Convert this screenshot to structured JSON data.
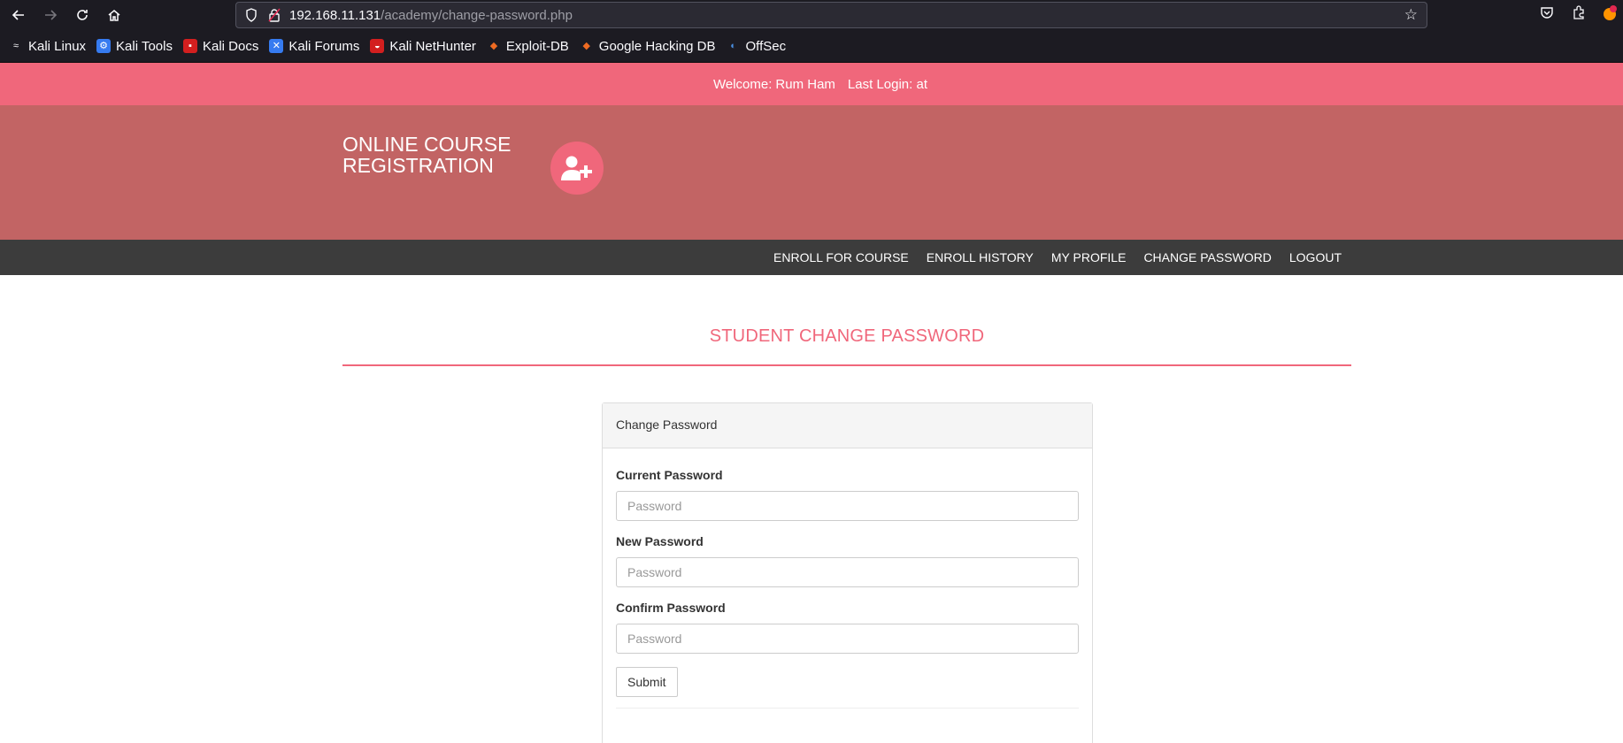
{
  "browser": {
    "url_host": "192.168.11.131",
    "url_path": "/academy/change-password.php",
    "bookmarks": [
      {
        "label": "Kali Linux",
        "color": "#367bf0"
      },
      {
        "label": "Kali Tools",
        "color": "#367bf0"
      },
      {
        "label": "Kali Docs",
        "color": "#d31f1f"
      },
      {
        "label": "Kali Forums",
        "color": "#367bf0"
      },
      {
        "label": "Kali NetHunter",
        "color": "#d31f1f"
      },
      {
        "label": "Exploit-DB",
        "color": "#ef6b22"
      },
      {
        "label": "Google Hacking DB",
        "color": "#ef6b22"
      },
      {
        "label": "OffSec",
        "color": "#4a90e2"
      }
    ]
  },
  "welcome": {
    "label": "Welcome:",
    "name": "Rum Ham",
    "last_login": "Last Login: at"
  },
  "header": {
    "logo_line1": "ONLINE COURSE",
    "logo_line2": "REGISTRATION"
  },
  "menu": [
    "ENROLL FOR COURSE",
    "ENROLL HISTORY",
    "MY PROFILE",
    "CHANGE PASSWORD",
    "LOGOUT"
  ],
  "main": {
    "page_title": "STUDENT CHANGE PASSWORD",
    "panel_heading": "Change Password",
    "fields": [
      {
        "label": "Current Password",
        "placeholder": "Password"
      },
      {
        "label": "New Password",
        "placeholder": "Password"
      },
      {
        "label": "Confirm Password",
        "placeholder": "Password"
      }
    ],
    "submit_label": "Submit"
  },
  "colors": {
    "accent": "#f0677b",
    "header_bg": "#c26464",
    "menu_bg": "#3c3c3c"
  }
}
